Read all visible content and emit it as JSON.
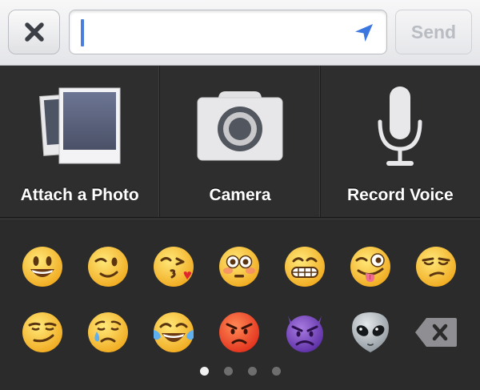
{
  "composer": {
    "close_icon": "close-x-icon",
    "input_value": "",
    "location_icon": "location-arrow-icon",
    "send_label": "Send",
    "accent": "#4a7de0"
  },
  "attachments": [
    {
      "icon": "photos-icon",
      "label": "Attach a Photo"
    },
    {
      "icon": "camera-icon",
      "label": "Camera"
    },
    {
      "icon": "microphone-icon",
      "label": "Record Voice"
    }
  ],
  "emojis": [
    [
      "grinning-face",
      "winking-face",
      "face-throwing-kiss",
      "flushed-face",
      "grimacing-face",
      "winking-face-tongue",
      "unamused-face"
    ],
    [
      "smirking-face",
      "crying-face",
      "tears-of-joy-face",
      "angry-face",
      "imp-face",
      "alien-face",
      "delete-key"
    ]
  ],
  "pager": {
    "pages": 4,
    "current": 0
  }
}
